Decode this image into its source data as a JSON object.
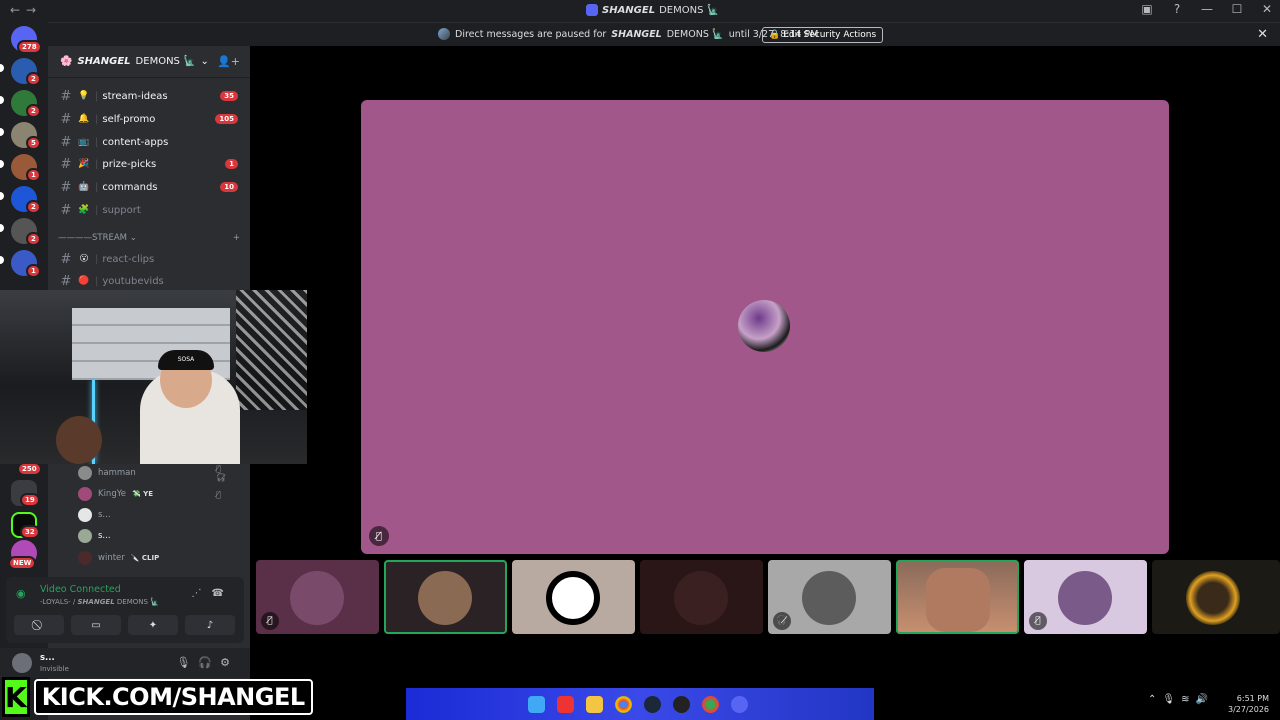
{
  "window": {
    "title_server": "SHANGEL",
    "title_rest": "DEMONS 🗽",
    "controls": [
      "—",
      "☐",
      "✕"
    ]
  },
  "notice": {
    "prefix": "Direct messages are paused for",
    "server": "SHANGEL",
    "server_rest": "DEMONS 🗽",
    "suffix": "until 3/27, 8:14 PM",
    "button": "Edit Security Actions"
  },
  "rail": {
    "badges": [
      "278",
      "2",
      "2",
      "5",
      "1",
      "2",
      "2",
      "1",
      "250",
      "19",
      "32"
    ],
    "new_label": "NEW"
  },
  "server_header": {
    "name_bold": "SHANGEL",
    "name_rest": "DEMONS 🗽"
  },
  "channels": [
    {
      "emoji": "💡",
      "name": "stream-ideas",
      "count": "35"
    },
    {
      "emoji": "🔔",
      "name": "self-promo",
      "count": "105"
    },
    {
      "emoji": "📺",
      "name": "content-apps",
      "count": ""
    },
    {
      "emoji": "🎉",
      "name": "prize-picks",
      "count": "1"
    },
    {
      "emoji": "🤖",
      "name": "commands",
      "count": "10"
    },
    {
      "emoji": "🧩",
      "name": "support",
      "count": ""
    }
  ],
  "category": {
    "label": "————STREAM ⌄",
    "add": "+"
  },
  "stream_channels": [
    {
      "emoji": "😮",
      "name": "react-clips"
    },
    {
      "emoji": "🔴",
      "name": "youtubevids"
    }
  ],
  "voice_users": [
    {
      "name": "hamman",
      "tag": "",
      "icons": "🎙̸ 🎧̸"
    },
    {
      "name": "KingYe",
      "tag": "💸 YE",
      "icons": "🎙̸"
    },
    {
      "name": "s...",
      "tag": "",
      "icons": ""
    },
    {
      "name": "s...",
      "tag": "",
      "icons": ""
    },
    {
      "name": "winter",
      "tag": "🔪 CLIP",
      "icons": ""
    }
  ],
  "voice_panel": {
    "status": "Video Connected",
    "channel_prefix": "-LOYALS- /",
    "channel_server": "SHANGEL",
    "channel_rest": "DEMONS 🗽",
    "buttons": [
      "camera-off",
      "screen-share",
      "activities",
      "soundboard"
    ]
  },
  "user_panel": {
    "name": "s...",
    "status": "Invisible"
  },
  "kick": {
    "logo": "K",
    "url": "KICK.COM/SHANGEL"
  },
  "clock": {
    "time": "6:51 PM",
    "date": "3/27/2026"
  },
  "webcam": {
    "hat_text": "SOSA"
  }
}
